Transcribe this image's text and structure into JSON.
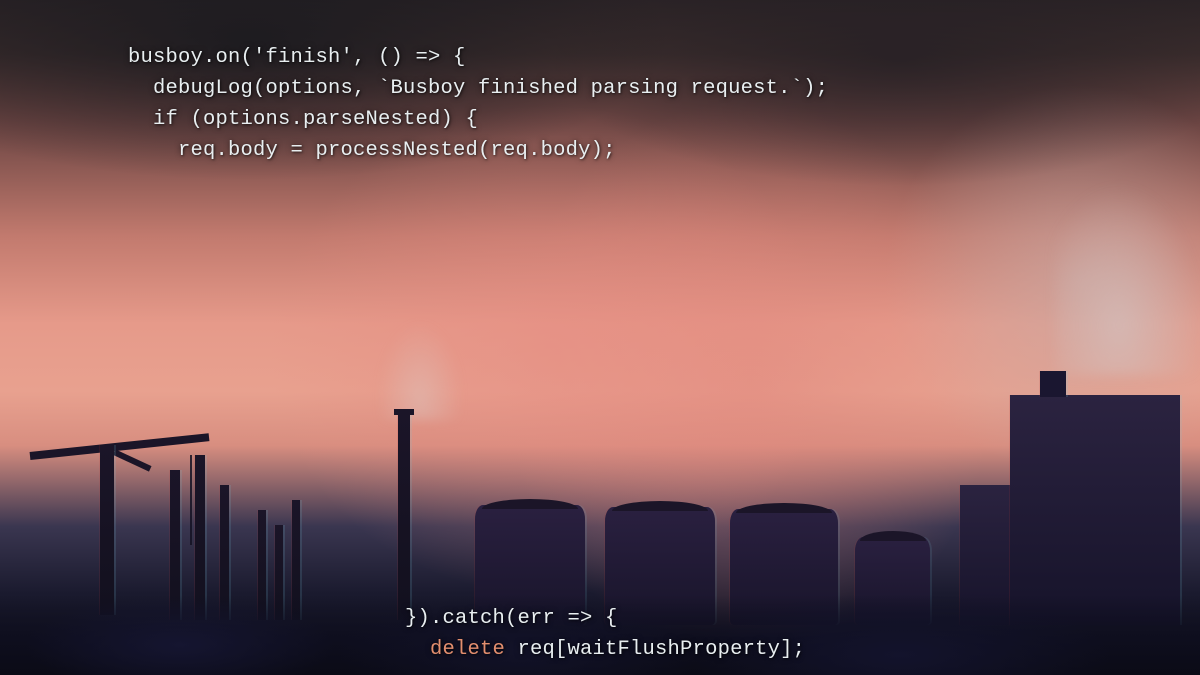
{
  "code": {
    "top": {
      "line1": "busboy.on('finish', () => {",
      "line2": "  debugLog(options, `Busboy finished parsing request.`);",
      "line3": "  if (options.parseNested) {",
      "line4": "    req.body = processNested(req.body);"
    },
    "bottom": {
      "line1": "}).catch(err => {",
      "line2_kw": "delete",
      "line2_rest": " req[waitFlushProperty];"
    }
  }
}
